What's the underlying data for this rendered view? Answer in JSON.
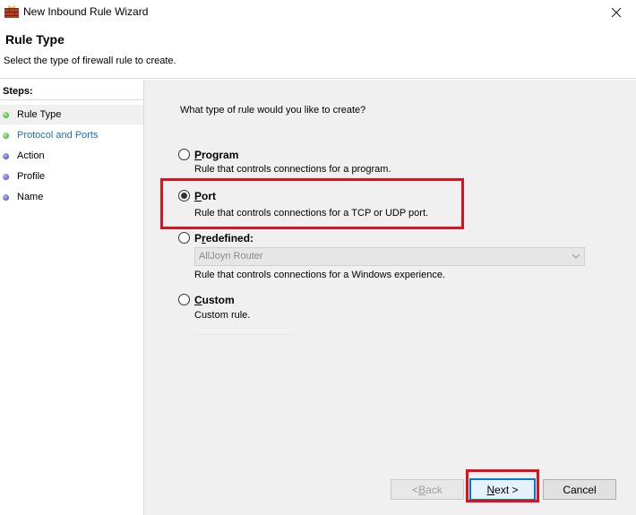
{
  "window": {
    "title": "New Inbound Rule Wizard",
    "close_glyph": "✕"
  },
  "header": {
    "title": "Rule Type",
    "subtitle": "Select the type of firewall rule to create."
  },
  "steps": {
    "heading": "Steps:",
    "items": [
      {
        "label": "Rule Type",
        "status": "completed",
        "active": true
      },
      {
        "label": "Protocol and Ports",
        "status": "completed",
        "active": false
      },
      {
        "label": "Action",
        "status": "pending",
        "active": false
      },
      {
        "label": "Profile",
        "status": "pending",
        "active": false
      },
      {
        "label": "Name",
        "status": "pending",
        "active": false
      }
    ]
  },
  "main": {
    "question": "What type of rule would you like to create?",
    "options": [
      {
        "mnemonic": "P",
        "rest": "rogram",
        "description": "Rule that controls connections for a program.",
        "selected": false
      },
      {
        "mnemonic": "P",
        "rest": "ort",
        "description": "Rule that controls connections for a TCP or UDP port.",
        "selected": true
      },
      {
        "pre": "P",
        "mnemonic": "r",
        "rest": "edefined:",
        "description": "Rule that controls connections for a Windows experience.",
        "selected": false
      },
      {
        "mnemonic": "C",
        "rest": "ustom",
        "description": "Custom rule.",
        "selected": false
      }
    ],
    "predefined_select": {
      "value": "AllJoyn Router",
      "enabled": false
    }
  },
  "footer": {
    "back_mnemonic": "B",
    "back_pre": "< ",
    "back_rest": "ack",
    "next_mnemonic": "N",
    "next_rest": "ext >",
    "cancel_label": "Cancel"
  },
  "colors": {
    "highlight": "#e0101c",
    "link": "#1f6fb5",
    "step_completed": "#2f9e1f",
    "step_pending": "#3a3bb8"
  },
  "icons": [
    "firewall-wizard-icon",
    "close-icon",
    "radio-button",
    "chevron-down-icon",
    "step-status-dot"
  ]
}
